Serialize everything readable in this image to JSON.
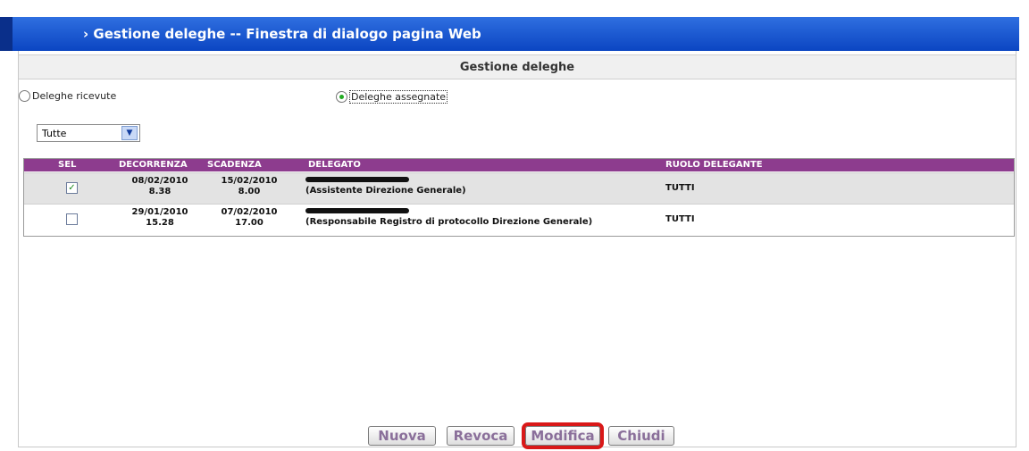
{
  "window": {
    "title": "› Gestione deleghe -- Finestra di dialogo pagina Web"
  },
  "dialog": {
    "header": "Gestione deleghe"
  },
  "radios": {
    "received": {
      "label": "Deleghe ricevute",
      "selected": false
    },
    "assigned": {
      "label": "Deleghe assegnate",
      "selected": true
    }
  },
  "filter": {
    "value": "Tutte"
  },
  "table": {
    "columns": [
      "SEL",
      "DECORRENZA",
      "SCADENZA",
      "DELEGATO",
      "RUOLO DELEGANTE"
    ],
    "rows": [
      {
        "checked": true,
        "decorrenza_date": "08/02/2010",
        "decorrenza_time": "8.38",
        "scadenza_date": "15/02/2010",
        "scadenza_time": "8.00",
        "delegato_role": "(Assistente Direzione Generale)",
        "ruolo": "TUTTI"
      },
      {
        "checked": false,
        "decorrenza_date": "29/01/2010",
        "decorrenza_time": "15.28",
        "scadenza_date": "07/02/2010",
        "scadenza_time": "17.00",
        "delegato_role": "(Responsabile Registro di protocollo Direzione Generale)",
        "ruolo": "TUTTI"
      }
    ]
  },
  "buttons": {
    "nuova": "Nuova",
    "revoca": "Revoca",
    "modifica": "Modifica",
    "chiudi": "Chiudi"
  },
  "colors": {
    "titlebar": "#0b45c2",
    "table_header": "#8d3c8e",
    "highlight": "#d91818"
  }
}
